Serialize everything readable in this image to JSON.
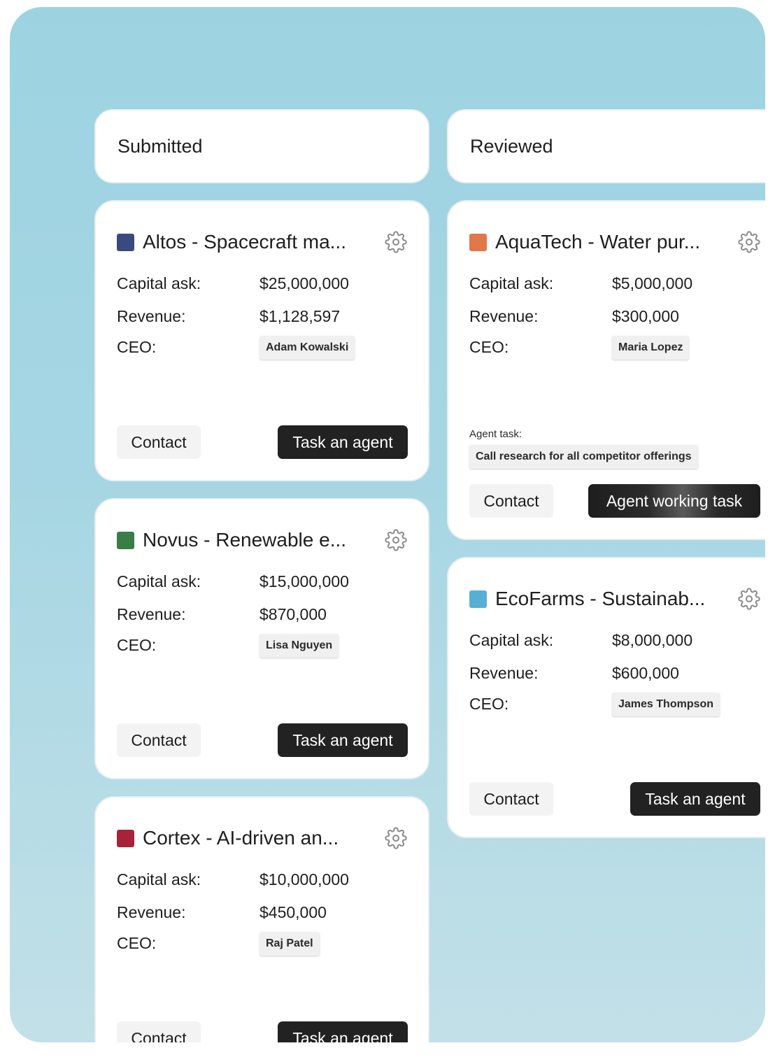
{
  "columns": [
    {
      "title": "Submitted",
      "cards": [
        {
          "title": "Altos - Spacecraft ma...",
          "color": "#3b4a7e",
          "capital_label": "Capital ask:",
          "capital": "$25,000,000",
          "revenue_label": "Revenue:",
          "revenue": "$1,128,597",
          "ceo_label": "CEO:",
          "ceo": "Adam Kowalski",
          "contact_label": "Contact",
          "action_label": "Task an agent"
        },
        {
          "title": "Novus - Renewable e...",
          "color": "#3a7d47",
          "capital_label": "Capital ask:",
          "capital": "$15,000,000",
          "revenue_label": "Revenue:",
          "revenue": "$870,000",
          "ceo_label": "CEO:",
          "ceo": "Lisa Nguyen",
          "contact_label": "Contact",
          "action_label": "Task an agent"
        },
        {
          "title": "Cortex - AI-driven an...",
          "color": "#a8233a",
          "capital_label": "Capital ask:",
          "capital": "$10,000,000",
          "revenue_label": "Revenue:",
          "revenue": "$450,000",
          "ceo_label": "CEO:",
          "ceo": "Raj Patel",
          "contact_label": "Contact",
          "action_label": "Task an agent"
        }
      ]
    },
    {
      "title": "Reviewed",
      "cards": [
        {
          "title": "AquaTech - Water pur...",
          "color": "#e2774a",
          "capital_label": "Capital ask:",
          "capital": "$5,000,000",
          "revenue_label": "Revenue:",
          "revenue": "$300,000",
          "ceo_label": "CEO:",
          "ceo": "Maria Lopez",
          "agent_task_label": "Agent task:",
          "agent_task": "Call research for all competitor offerings",
          "contact_label": "Contact",
          "action_label": "Agent working task"
        },
        {
          "title": "EcoFarms - Sustainab...",
          "color": "#56b0d6",
          "capital_label": "Capital ask:",
          "capital": "$8,000,000",
          "revenue_label": "Revenue:",
          "revenue": "$600,000",
          "ceo_label": "CEO:",
          "ceo": "James Thompson",
          "contact_label": "Contact",
          "action_label": "Task an agent"
        }
      ]
    }
  ],
  "icons": {
    "settings": "gear-icon"
  }
}
